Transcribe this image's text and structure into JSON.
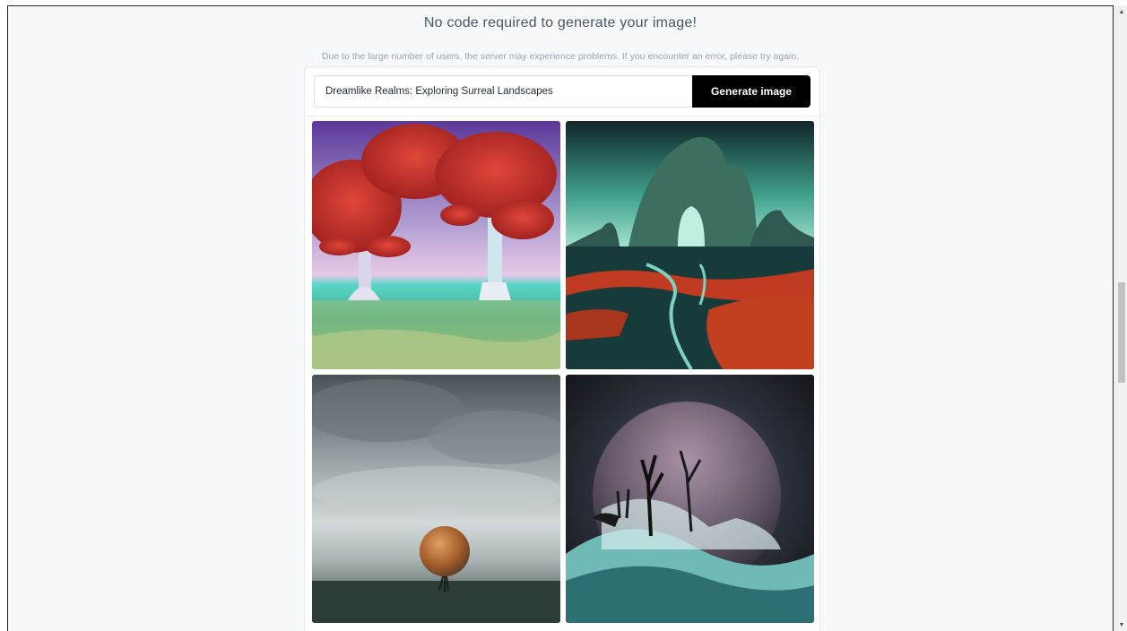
{
  "page": {
    "heading": "No code required to generate your image!",
    "notice": "Due to the large number of users, the server may experience problems. If you encounter an error, please try again."
  },
  "generator": {
    "prompt_value": "Dreamlike Realms: Exploring Surreal Landscapes",
    "button_label": "Generate image"
  },
  "images": [
    {
      "subject": "red-trees-landscape"
    },
    {
      "subject": "rock-arch-river-landscape"
    },
    {
      "subject": "orb-tree-stormy-landscape"
    },
    {
      "subject": "dead-trees-sphere-landscape"
    }
  ],
  "scrollbar": {
    "up_icon": "triangle-up-icon",
    "down_icon": "triangle-down-icon"
  }
}
